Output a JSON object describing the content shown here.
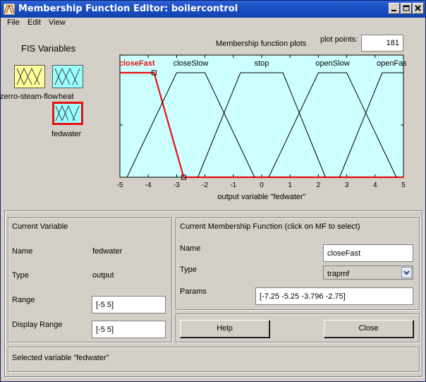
{
  "window": {
    "title": "Membership Function Editor: boilercontrol"
  },
  "menu": [
    "File",
    "Edit",
    "View"
  ],
  "fis": {
    "title": "FIS Variables",
    "variables": [
      {
        "label": "zerro-steam-flow"
      },
      {
        "label": "heat"
      },
      {
        "label": "fedwater"
      }
    ]
  },
  "plot": {
    "header": "Membership function plots",
    "plot_points_label": "plot points:",
    "plot_points_value": "181",
    "selected_color": "#e81010",
    "background_color": "#ccffff"
  },
  "chart_data": {
    "type": "line",
    "xlabel": "output variable \"fedwater\"",
    "xlim": [
      -5,
      5
    ],
    "ylim": [
      0,
      1
    ],
    "xticks": [
      "-5",
      "-4",
      "-3",
      "-2",
      "-1",
      "0",
      "1",
      "2",
      "3",
      "4",
      "5"
    ],
    "yticks": [
      "0",
      "0.5",
      "1"
    ],
    "series": [
      {
        "name": "closeFast",
        "params": [
          -7.25,
          -5.25,
          -3.796,
          -2.75
        ],
        "selected": true
      },
      {
        "name": "closeSlow",
        "params": [
          -4.75,
          -3.0,
          -2.0,
          -0.25
        ],
        "selected": false
      },
      {
        "name": "stop",
        "params": [
          -2.25,
          -0.75,
          0.75,
          2.25
        ],
        "selected": false
      },
      {
        "name": "openSlow",
        "params": [
          0.25,
          2.0,
          3.0,
          4.75
        ],
        "selected": false
      },
      {
        "name": "openFast",
        "params": [
          2.75,
          4.25,
          6.0,
          7.5
        ],
        "selected": false
      }
    ]
  },
  "current_variable": {
    "title": "Current Variable",
    "name_label": "Name",
    "name_value": "fedwater",
    "type_label": "Type",
    "type_value": "output",
    "range_label": "Range",
    "range_value": "[-5 5]",
    "display_range_label": "Display Range",
    "display_range_value": "[-5 5]"
  },
  "current_mf": {
    "title": "Current Membership Function (click on MF to select)",
    "name_label": "Name",
    "name_value": "closeFast",
    "type_label": "Type",
    "type_value": "trapmf",
    "params_label": "Params",
    "params_value": "[-7.25 -5.25 -3.796 -2.75]"
  },
  "buttons": {
    "help": "Help",
    "close": "Close"
  },
  "status": "Selected variable \"fedwater\""
}
